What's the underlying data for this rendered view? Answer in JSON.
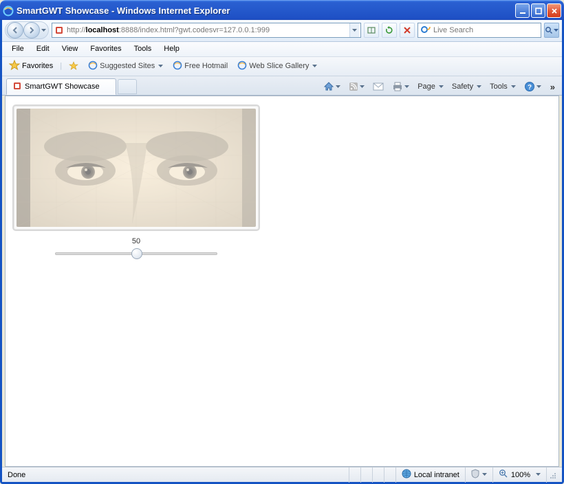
{
  "window": {
    "title": "SmartGWT Showcase - Windows Internet Explorer"
  },
  "address": {
    "protocol": "http://",
    "host": "localhost",
    "port_path": ":8888/index.html?gwt.codesvr=127.0.0.1:999"
  },
  "search": {
    "placeholder": "Live Search"
  },
  "menu": {
    "file": "File",
    "edit": "Edit",
    "view": "View",
    "favorites": "Favorites",
    "tools": "Tools",
    "help": "Help"
  },
  "favbar": {
    "favorites": "Favorites",
    "suggested": "Suggested Sites",
    "hotmail": "Free Hotmail",
    "webslice": "Web Slice Gallery"
  },
  "tabs": {
    "active": "SmartGWT Showcase"
  },
  "toolbar": {
    "page": "Page",
    "safety": "Safety",
    "tools": "Tools"
  },
  "slider": {
    "value": "50",
    "percent": 50
  },
  "status": {
    "done": "Done",
    "zone": "Local intranet",
    "zoom": "100%"
  }
}
